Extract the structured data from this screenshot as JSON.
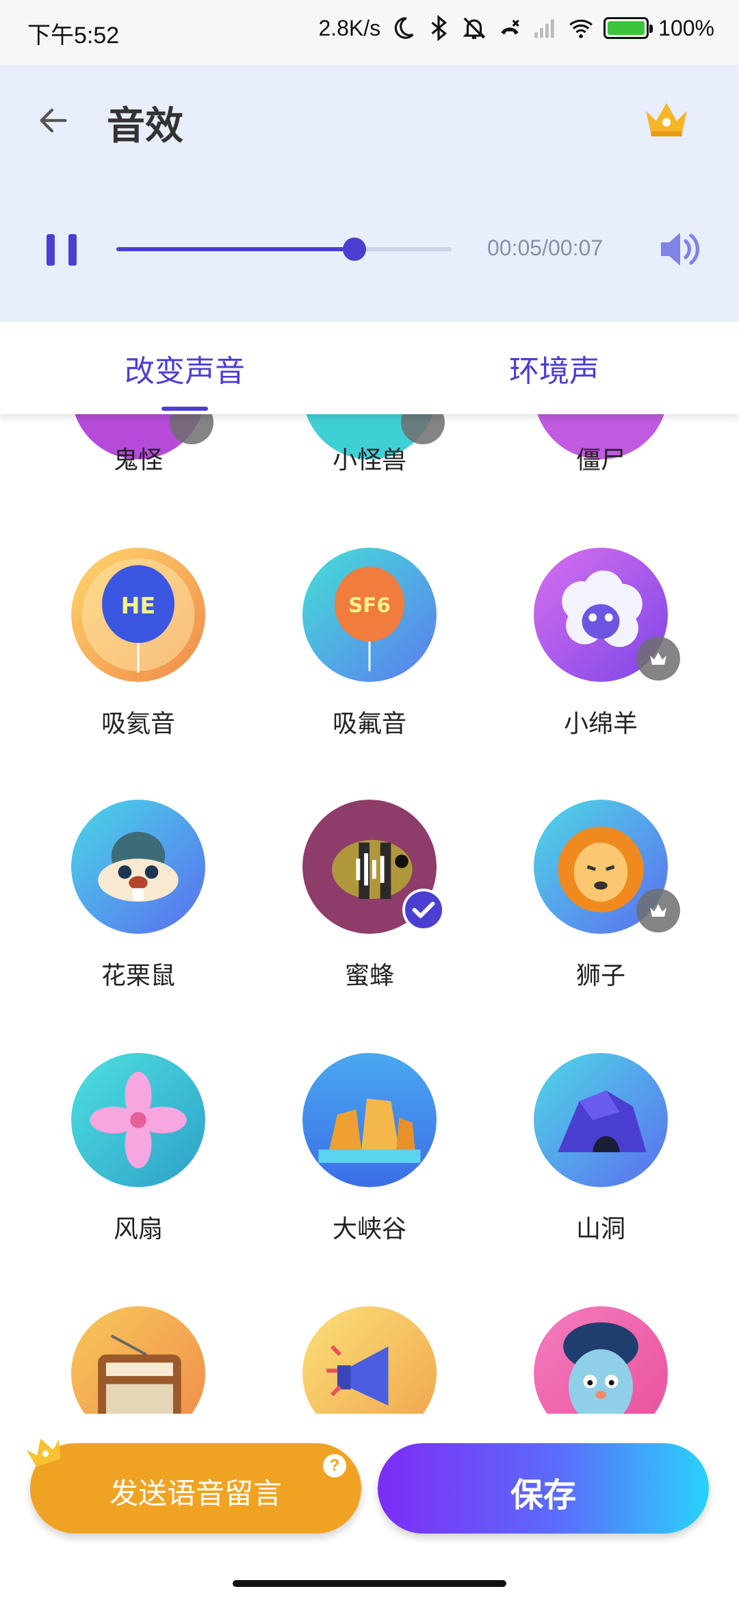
{
  "status_bar": {
    "time": "下午5:52",
    "speed": "2.8K/s",
    "battery": "100%",
    "icons": [
      "moon-icon",
      "bluetooth-icon",
      "mute-bell-icon",
      "call-icon",
      "signal-icon",
      "wifi-icon",
      "battery-icon"
    ]
  },
  "header": {
    "title": "音效",
    "back_icon": "arrow-left-icon",
    "premium_icon": "crown-icon"
  },
  "player": {
    "state_icon": "pause-icon",
    "progress": 0.71,
    "time": "00:05/00:07",
    "volume_icon": "speaker-icon"
  },
  "tabs": [
    {
      "label": "改变声音",
      "active": true
    },
    {
      "label": "环境声",
      "active": false
    }
  ],
  "effects": [
    {
      "label": "鬼怪",
      "icon": "ghost-icon"
    },
    {
      "label": "小怪兽",
      "icon": "monster-icon"
    },
    {
      "label": "僵尸",
      "icon": "zombie-icon"
    },
    {
      "label": "吸氦音",
      "icon": "he-balloon-icon",
      "balloon_text": "HE"
    },
    {
      "label": "吸氟音",
      "icon": "sf6-balloon-icon",
      "balloon_text": "SF6"
    },
    {
      "label": "小绵羊",
      "icon": "sheep-icon",
      "premium": true
    },
    {
      "label": "花栗鼠",
      "icon": "chipmunk-icon"
    },
    {
      "label": "蜜蜂",
      "icon": "bee-icon",
      "selected": true
    },
    {
      "label": "狮子",
      "icon": "lion-icon",
      "premium": true
    },
    {
      "label": "风扇",
      "icon": "fan-icon"
    },
    {
      "label": "大峡谷",
      "icon": "canyon-icon"
    },
    {
      "label": "山洞",
      "icon": "cave-icon"
    },
    {
      "label": "",
      "icon": "radio-icon"
    },
    {
      "label": "",
      "icon": "megaphone-icon"
    },
    {
      "label": "",
      "icon": "nervous-face-icon"
    }
  ],
  "colors": {
    "accent": "#4b3fd1",
    "header_bg": "#e9eefd",
    "send_button": "#f0a323",
    "save_gradient_start": "#7d2cf5",
    "save_gradient_end": "#29d3fb"
  },
  "buttons": {
    "send_voice_message": "发送语音留言",
    "help": "?",
    "save": "保存"
  }
}
